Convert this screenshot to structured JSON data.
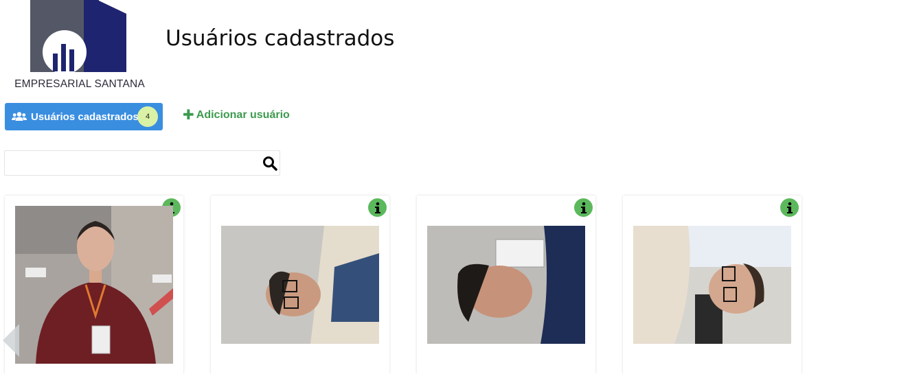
{
  "brand": {
    "name": "EMPRESARIAL SANTANA"
  },
  "page": {
    "title": "Usuários cadastrados"
  },
  "toolbar": {
    "users_button_label": "Usuários cadastrados",
    "users_count": "4",
    "add_user_label": "Adicionar usuário"
  },
  "search": {
    "value": "",
    "placeholder": ""
  },
  "colors": {
    "primary_button": "#3a8ee0",
    "badge": "#d9f2a6",
    "add_link": "#3c9a4e",
    "info_icon": "#5cb85c",
    "logo_gray": "#545866",
    "logo_navy": "#1f2470"
  },
  "users": [
    {
      "photo": "user-photo",
      "info_icon": "info-icon"
    },
    {
      "photo": "user-photo",
      "info_icon": "info-icon"
    },
    {
      "photo": "user-photo",
      "info_icon": "info-icon"
    },
    {
      "photo": "user-photo",
      "info_icon": "info-icon"
    }
  ]
}
